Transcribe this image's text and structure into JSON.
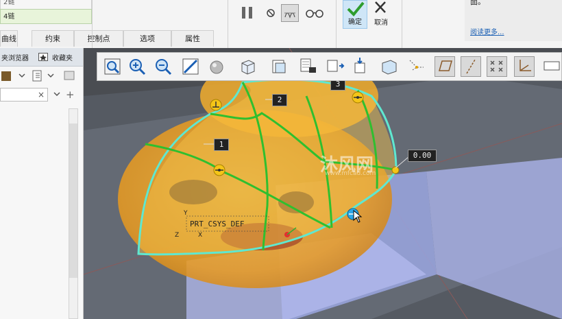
{
  "ribbon": {
    "chain_upper": "2链",
    "chain_lower": "4链",
    "tabs": [
      "曲线",
      "约束",
      "控制点",
      "选项",
      "属性"
    ],
    "ok_label": "确定",
    "cancel_label": "取消",
    "help_text": "面。",
    "read_more": "阅读更多..."
  },
  "left_panel": {
    "nav_tabs": [
      "夹浏览器",
      "收藏夹"
    ]
  },
  "viewport": {
    "dim_labels": [
      "2",
      "1",
      "0.00",
      "3"
    ],
    "csys_label": "PRT_CSYS_DEF",
    "axis_labels": [
      "Y",
      "Z",
      "X"
    ],
    "watermark": "沐风网",
    "watermark_url": "www.mfcad.com"
  },
  "colors": {
    "accent_blue": "#1a5fb4",
    "curve_green": "#2fbf2f",
    "boundary_cyan": "#5fe8d0",
    "handle_yellow": "#f5c518",
    "surface_orange": "#f0a020"
  }
}
